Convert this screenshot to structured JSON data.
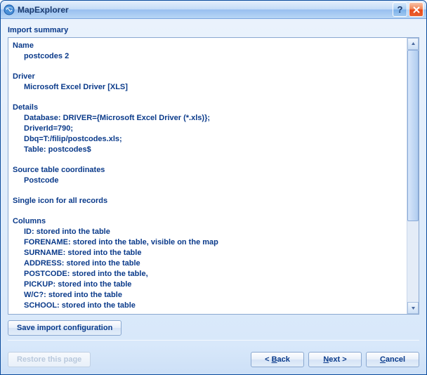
{
  "window": {
    "title": "MapExplorer"
  },
  "section_title": "Import summary",
  "summary": {
    "name_label": "Name",
    "name_value": "postcodes 2",
    "driver_label": "Driver",
    "driver_value": "Microsoft Excel Driver [XLS]",
    "details_label": "Details",
    "details_lines": {
      "l1": "Database: DRIVER={Microsoft Excel Driver (*.xls)};",
      "l2": "DriverId=790;",
      "l3": "Dbq=T:/filip/postcodes.xls;",
      "l4": "Table: postcodes$"
    },
    "coords_label": "Source table coordinates",
    "coords_value": "Postcode",
    "icon_label": "Single icon for all records",
    "columns_label": "Columns",
    "columns": {
      "c1": "ID: stored into the table",
      "c2": "FORENAME: stored into the table, visible on the map",
      "c3": "SURNAME: stored into the table",
      "c4": "ADDRESS: stored into the table",
      "c5": "POSTCODE: stored into the table,",
      "c6": "PICKUP: stored into the table",
      "c7": "W/C?: stored into the table",
      "c8": "SCHOOL: stored into the table"
    }
  },
  "buttons": {
    "save_config": "Save import configuration",
    "restore": "Restore this page",
    "back_prefix": "< ",
    "back_u": "B",
    "back_rest": "ack",
    "next_u": "N",
    "next_rest": "ext >",
    "cancel_u": "C",
    "cancel_rest": "ancel"
  }
}
